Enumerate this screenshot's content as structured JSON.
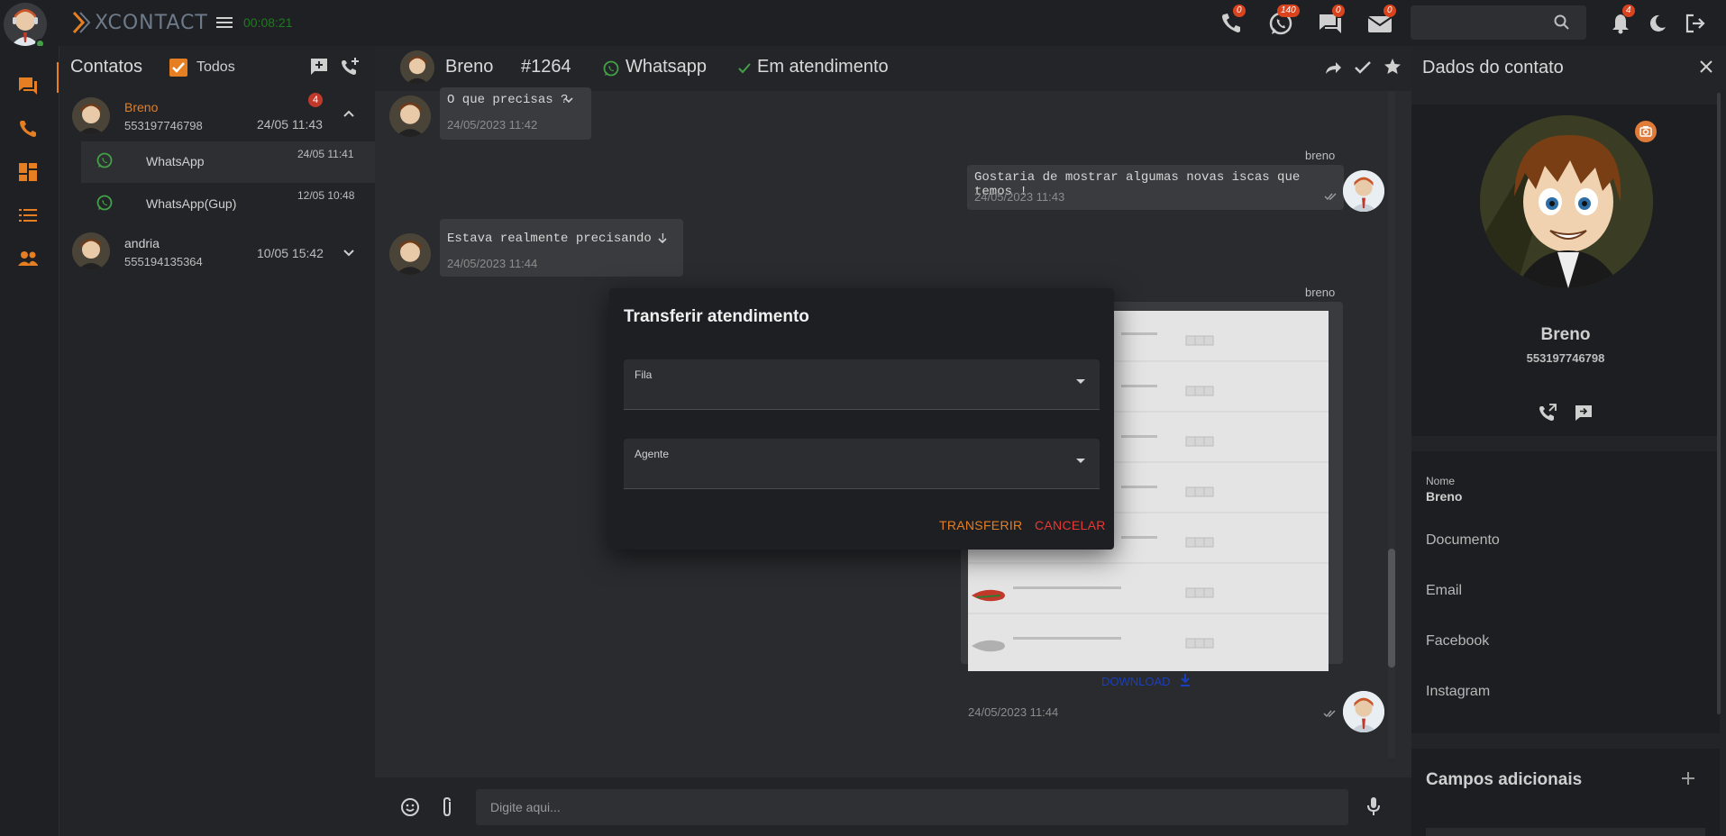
{
  "app": {
    "logo_text": "XCONTACT",
    "timer": "00:08:21"
  },
  "topbar": {
    "badges": {
      "phone": "0",
      "whatsapp": "140",
      "chat": "0",
      "email": "0",
      "notifications": "4"
    },
    "search_placeholder": ""
  },
  "contacts": {
    "title": "Contatos",
    "filter_label": "Todos",
    "items": [
      {
        "name": "Breno",
        "phone": "553197746798",
        "time": "24/05 11:43",
        "unread": "4"
      },
      {
        "name": "andria",
        "phone": "555194135364",
        "time": "10/05 15:42"
      }
    ],
    "channels": [
      {
        "label": "WhatsApp",
        "time": "24/05 11:41"
      },
      {
        "label": "WhatsApp(Gup)",
        "time": "12/05 10:48"
      }
    ]
  },
  "chat_header": {
    "name": "Breno",
    "ticket": "#1264",
    "channel": "Whatsapp",
    "status": "Em atendimento"
  },
  "messages": [
    {
      "text": "O que precisas ?",
      "time": "24/05/2023 11:42"
    },
    {
      "sender": "breno",
      "text": "Gostaria de mostrar algumas novas iscas que temos !",
      "time": "24/05/2023 11:43"
    },
    {
      "text": "Estava realmente precisando !",
      "time": "24/05/2023 11:44"
    },
    {
      "sender": "breno",
      "download": "DOWNLOAD",
      "time": "24/05/2023 11:44"
    }
  ],
  "composer": {
    "placeholder": "Digite aqui..."
  },
  "right_panel": {
    "title": "Dados do contato",
    "name": "Breno",
    "phone": "553197746798",
    "fields": {
      "nome_label": "Nome",
      "nome_value": "Breno",
      "documento": "Documento",
      "email": "Email",
      "facebook": "Facebook",
      "instagram": "Instagram"
    },
    "extra_title": "Campos adicionais"
  },
  "modal": {
    "title": "Transferir atendimento",
    "fila_label": "Fila",
    "agente_label": "Agente",
    "transfer_button": "TRANSFERIR",
    "cancel_button": "CANCELAR"
  },
  "colors": {
    "accent": "#e67e22",
    "danger": "#e53935",
    "whatsapp": "#43a047"
  }
}
